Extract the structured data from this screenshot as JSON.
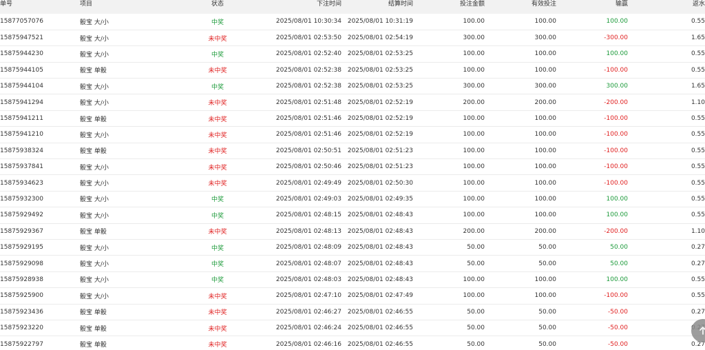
{
  "columns": {
    "id": "单号",
    "item": "项目",
    "status": "状态",
    "bet_time": "下注时间",
    "settle_time": "结算时间",
    "amount": "投注金额",
    "effective": "有效投注",
    "win_loss": "输赢",
    "rebate": "返水"
  },
  "colors": {
    "win": "#1c9a3a",
    "lose": "#e02020",
    "header_bg": "#f2f2f2"
  },
  "rows": [
    {
      "id": "15877057076",
      "item": "骰宝 大/小",
      "status": "中奖",
      "win": true,
      "bet_time": "2025/08/01 10:30:34",
      "settle_time": "2025/08/01 10:31:19",
      "amount": "100.00",
      "effective": "100.00",
      "win_loss": "100.00",
      "rebate": "0.55"
    },
    {
      "id": "15875947521",
      "item": "骰宝 大/小",
      "status": "未中奖",
      "win": false,
      "bet_time": "2025/08/01 02:53:50",
      "settle_time": "2025/08/01 02:54:19",
      "amount": "300.00",
      "effective": "300.00",
      "win_loss": "-300.00",
      "rebate": "1.65"
    },
    {
      "id": "15875944230",
      "item": "骰宝 大/小",
      "status": "中奖",
      "win": true,
      "bet_time": "2025/08/01 02:52:40",
      "settle_time": "2025/08/01 02:53:25",
      "amount": "100.00",
      "effective": "100.00",
      "win_loss": "100.00",
      "rebate": "0.55"
    },
    {
      "id": "15875944105",
      "item": "骰宝 单骰",
      "status": "未中奖",
      "win": false,
      "bet_time": "2025/08/01 02:52:38",
      "settle_time": "2025/08/01 02:53:25",
      "amount": "100.00",
      "effective": "100.00",
      "win_loss": "-100.00",
      "rebate": "0.55"
    },
    {
      "id": "15875944104",
      "item": "骰宝 大/小",
      "status": "中奖",
      "win": true,
      "bet_time": "2025/08/01 02:52:38",
      "settle_time": "2025/08/01 02:53:25",
      "amount": "300.00",
      "effective": "300.00",
      "win_loss": "300.00",
      "rebate": "1.65"
    },
    {
      "id": "15875941294",
      "item": "骰宝 大/小",
      "status": "未中奖",
      "win": false,
      "bet_time": "2025/08/01 02:51:48",
      "settle_time": "2025/08/01 02:52:19",
      "amount": "200.00",
      "effective": "200.00",
      "win_loss": "-200.00",
      "rebate": "1.10"
    },
    {
      "id": "15875941211",
      "item": "骰宝 单骰",
      "status": "未中奖",
      "win": false,
      "bet_time": "2025/08/01 02:51:46",
      "settle_time": "2025/08/01 02:52:19",
      "amount": "100.00",
      "effective": "100.00",
      "win_loss": "-100.00",
      "rebate": "0.55"
    },
    {
      "id": "15875941210",
      "item": "骰宝 大/小",
      "status": "未中奖",
      "win": false,
      "bet_time": "2025/08/01 02:51:46",
      "settle_time": "2025/08/01 02:52:19",
      "amount": "100.00",
      "effective": "100.00",
      "win_loss": "-100.00",
      "rebate": "0.55"
    },
    {
      "id": "15875938324",
      "item": "骰宝 单骰",
      "status": "未中奖",
      "win": false,
      "bet_time": "2025/08/01 02:50:51",
      "settle_time": "2025/08/01 02:51:23",
      "amount": "100.00",
      "effective": "100.00",
      "win_loss": "-100.00",
      "rebate": "0.55"
    },
    {
      "id": "15875937841",
      "item": "骰宝 大/小",
      "status": "未中奖",
      "win": false,
      "bet_time": "2025/08/01 02:50:46",
      "settle_time": "2025/08/01 02:51:23",
      "amount": "100.00",
      "effective": "100.00",
      "win_loss": "-100.00",
      "rebate": "0.55"
    },
    {
      "id": "15875934623",
      "item": "骰宝 大/小",
      "status": "未中奖",
      "win": false,
      "bet_time": "2025/08/01 02:49:49",
      "settle_time": "2025/08/01 02:50:30",
      "amount": "100.00",
      "effective": "100.00",
      "win_loss": "-100.00",
      "rebate": "0.55"
    },
    {
      "id": "15875932300",
      "item": "骰宝 大/小",
      "status": "中奖",
      "win": true,
      "bet_time": "2025/08/01 02:49:03",
      "settle_time": "2025/08/01 02:49:35",
      "amount": "100.00",
      "effective": "100.00",
      "win_loss": "100.00",
      "rebate": "0.55"
    },
    {
      "id": "15875929492",
      "item": "骰宝 大/小",
      "status": "中奖",
      "win": true,
      "bet_time": "2025/08/01 02:48:15",
      "settle_time": "2025/08/01 02:48:43",
      "amount": "100.00",
      "effective": "100.00",
      "win_loss": "100.00",
      "rebate": "0.55"
    },
    {
      "id": "15875929367",
      "item": "骰宝 单骰",
      "status": "未中奖",
      "win": false,
      "bet_time": "2025/08/01 02:48:13",
      "settle_time": "2025/08/01 02:48:43",
      "amount": "200.00",
      "effective": "200.00",
      "win_loss": "-200.00",
      "rebate": "1.10"
    },
    {
      "id": "15875929195",
      "item": "骰宝 大/小",
      "status": "中奖",
      "win": true,
      "bet_time": "2025/08/01 02:48:09",
      "settle_time": "2025/08/01 02:48:43",
      "amount": "50.00",
      "effective": "50.00",
      "win_loss": "50.00",
      "rebate": "0.27"
    },
    {
      "id": "15875929098",
      "item": "骰宝 大/小",
      "status": "中奖",
      "win": true,
      "bet_time": "2025/08/01 02:48:07",
      "settle_time": "2025/08/01 02:48:43",
      "amount": "50.00",
      "effective": "50.00",
      "win_loss": "50.00",
      "rebate": "0.27"
    },
    {
      "id": "15875928938",
      "item": "骰宝 大/小",
      "status": "中奖",
      "win": true,
      "bet_time": "2025/08/01 02:48:03",
      "settle_time": "2025/08/01 02:48:43",
      "amount": "100.00",
      "effective": "100.00",
      "win_loss": "100.00",
      "rebate": "0.55"
    },
    {
      "id": "15875925900",
      "item": "骰宝 大/小",
      "status": "未中奖",
      "win": false,
      "bet_time": "2025/08/01 02:47:10",
      "settle_time": "2025/08/01 02:47:49",
      "amount": "100.00",
      "effective": "100.00",
      "win_loss": "-100.00",
      "rebate": "0.55"
    },
    {
      "id": "15875923436",
      "item": "骰宝 单骰",
      "status": "未中奖",
      "win": false,
      "bet_time": "2025/08/01 02:46:27",
      "settle_time": "2025/08/01 02:46:55",
      "amount": "50.00",
      "effective": "50.00",
      "win_loss": "-50.00",
      "rebate": "0.27"
    },
    {
      "id": "15875923220",
      "item": "骰宝 单骰",
      "status": "未中奖",
      "win": false,
      "bet_time": "2025/08/01 02:46:24",
      "settle_time": "2025/08/01 02:46:55",
      "amount": "50.00",
      "effective": "50.00",
      "win_loss": "-50.00",
      "rebate": "0.27"
    },
    {
      "id": "15875922797",
      "item": "骰宝 单骰",
      "status": "未中奖",
      "win": false,
      "bet_time": "2025/08/01 02:46:16",
      "settle_time": "2025/08/01 02:46:55",
      "amount": "50.00",
      "effective": "50.00",
      "win_loss": "-50.00",
      "rebate": "0.27"
    }
  ],
  "scroll_top_icon": "arrow-up-icon"
}
